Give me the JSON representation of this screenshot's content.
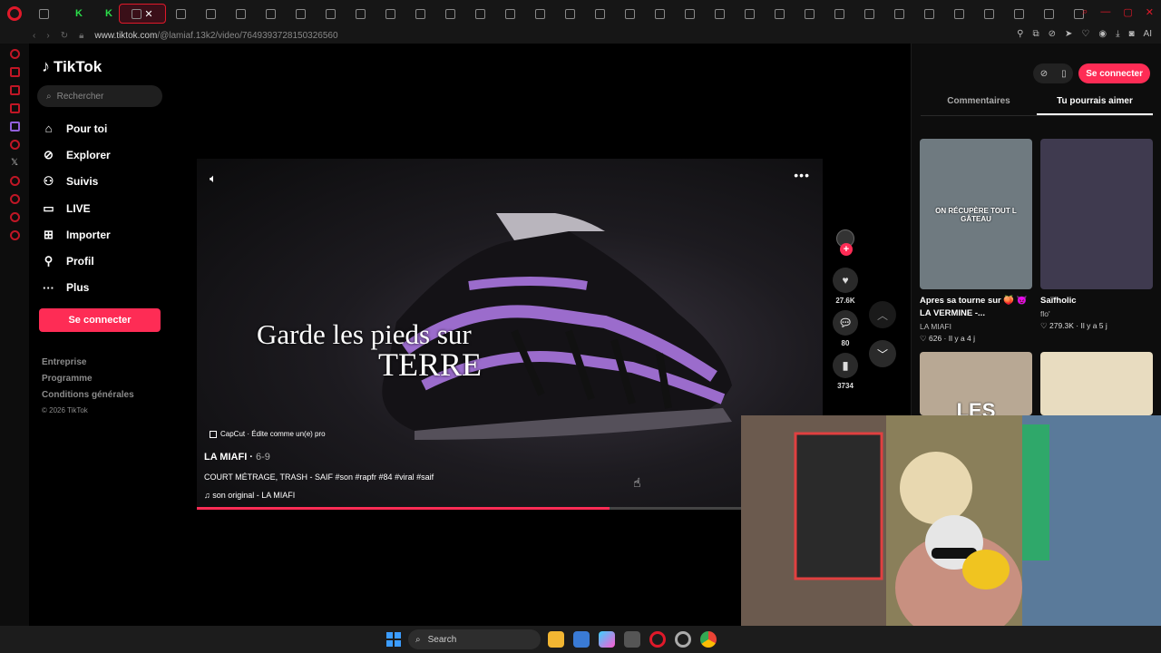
{
  "browser": {
    "tabs": [
      "",
      "K",
      "K",
      "",
      "",
      "",
      "",
      "",
      "",
      "",
      "",
      "",
      "",
      "",
      "",
      "",
      "",
      "",
      "",
      "",
      "",
      "",
      "",
      "",
      "",
      "",
      "",
      "",
      "",
      "",
      "",
      "",
      "",
      "",
      ""
    ],
    "url_host": "www.tiktok.com",
    "url_path": "/@lamiaf.13k2/video/7649393728150326560",
    "add_tab_icon": "plus-icon"
  },
  "sidebar": {
    "logo": "TikTok",
    "search_placeholder": "Rechercher",
    "menu": [
      {
        "label": "Pour toi",
        "icon": "home-icon"
      },
      {
        "label": "Explorer",
        "icon": "compass-icon"
      },
      {
        "label": "Suivis",
        "icon": "following-icon"
      },
      {
        "label": "LIVE",
        "icon": "live-icon"
      },
      {
        "label": "Importer",
        "icon": "upload-icon"
      },
      {
        "label": "Profil",
        "icon": "profile-icon"
      },
      {
        "label": "Plus",
        "icon": "more-icon"
      }
    ],
    "login_button": "Se connecter",
    "footer": [
      "Entreprise",
      "Programme",
      "Conditions générales"
    ],
    "copyright": "© 2026 TikTok"
  },
  "video": {
    "overlay_line1": "Garde les pieds sur",
    "overlay_line2": "TERRE",
    "capcut": "CapCut · Édite comme un(e) pro",
    "author": "LA MIAFI",
    "date": "6-9",
    "caption": "COURT MÉTRAGE, TRASH - SAIF #son #rapfr #84 #viral #saif",
    "sound": "son original - LA MIAFI",
    "progress": 0.66,
    "likes": "27.6K",
    "comments": "80",
    "saves": "3734"
  },
  "right_panel": {
    "tab_comments": "Commentaires",
    "tab_suggested": "Tu pourrais aimer",
    "login_button": "Se connecter",
    "cards": [
      {
        "title": "Apres sa tourne sur 🍑 😈 LA VERMINE -...",
        "author": "LA MIAFI",
        "likes": "626",
        "age": "Il y a 4 j",
        "thumb_text": "ON RÉCUPÈRE TOUT L GÂTEAU",
        "color": "#6f7a80"
      },
      {
        "title": "Saïfholic",
        "author": "flo'",
        "likes": "279.3K",
        "age": "Il y a 5 j",
        "thumb_text": "",
        "color": "#3f3a4f"
      },
      {
        "title": "",
        "author": "",
        "likes": "",
        "age": "",
        "thumb_text": "LES",
        "color": "#b8a894"
      },
      {
        "title": "",
        "author": "",
        "likes": "",
        "age": "",
        "thumb_text": "",
        "color": "#e8dcc0"
      }
    ]
  },
  "taskbar": {
    "search": "Search"
  }
}
